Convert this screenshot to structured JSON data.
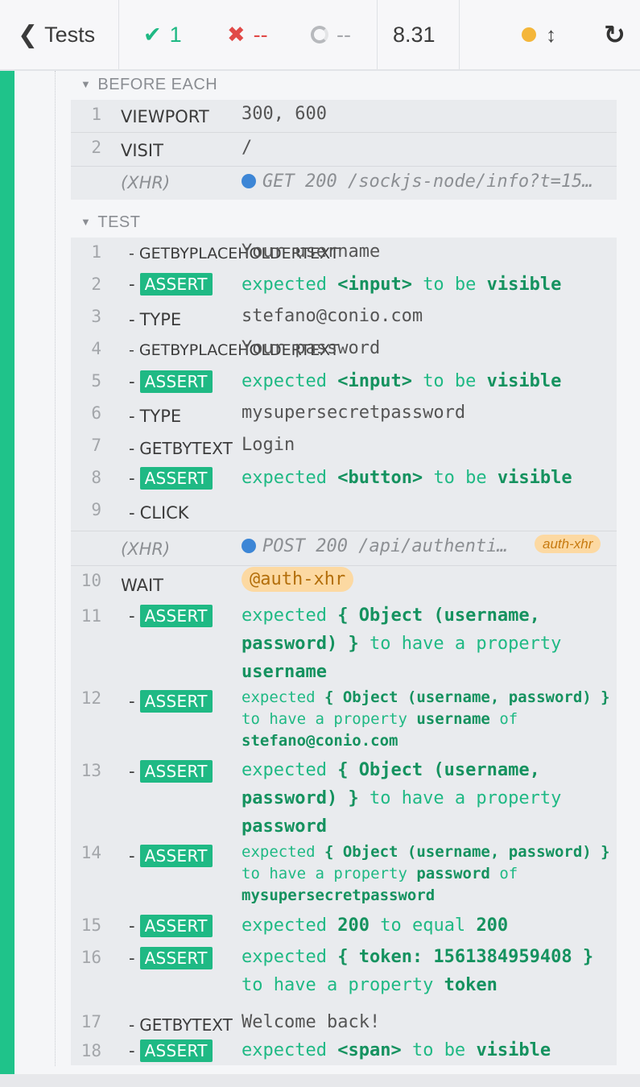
{
  "header": {
    "back_label": "Tests",
    "passed": "1",
    "failed": "--",
    "pending": "--",
    "duration": "8.31",
    "indicator_color": "#f4b63a"
  },
  "before_each": {
    "title": "BEFORE EACH",
    "commands": [
      {
        "num": "1",
        "name": "VIEWPORT",
        "message": "300, 600"
      },
      {
        "num": "2",
        "name": "VISIT",
        "message": "/"
      },
      {
        "num": "",
        "name": "(XHR)",
        "message": "GET 200 /sockjs-node/info?t=15…"
      }
    ]
  },
  "test": {
    "title": "TEST",
    "commands": [
      {
        "num": "1",
        "name": "GETBYPLACEHOLDERTEXT",
        "message": "Your username"
      },
      {
        "num": "2",
        "name": "ASSERT",
        "pre": "expected",
        "subject": "<input>",
        "mid": "to be",
        "value": "visible"
      },
      {
        "num": "3",
        "name": "TYPE",
        "message": "stefano@conio.com"
      },
      {
        "num": "4",
        "name": "GETBYPLACEHOLDERTEXT",
        "message": "Your password"
      },
      {
        "num": "5",
        "name": "ASSERT",
        "pre": "expected",
        "subject": "<input>",
        "mid": "to be",
        "value": "visible"
      },
      {
        "num": "6",
        "name": "TYPE",
        "message": "mysupersecretpassword"
      },
      {
        "num": "7",
        "name": "GETBYTEXT",
        "message": "Login"
      },
      {
        "num": "8",
        "name": "ASSERT",
        "pre": "expected",
        "subject": "<button>",
        "mid": "to be",
        "value": "visible"
      },
      {
        "num": "9",
        "name": "CLICK",
        "message": ""
      },
      {
        "num": "",
        "name": "(XHR)",
        "message": "POST 200 /api/authenti…",
        "alias": "auth-xhr"
      },
      {
        "num": "10",
        "name": "WAIT",
        "message": "@auth-xhr"
      },
      {
        "num": "11",
        "name": "ASSERT",
        "pre": "expected",
        "subject": "{ Object (username, password) }",
        "mid": "to have a property",
        "value": "username"
      },
      {
        "num": "12",
        "name": "ASSERT",
        "pre": "expected",
        "subject": "{ Object (username, password) }",
        "mid": "to have a property",
        "value": "username",
        "of": "of",
        "extra": "stefano@conio.com"
      },
      {
        "num": "13",
        "name": "ASSERT",
        "pre": "expected",
        "subject": "{ Object (username, password) }",
        "mid": "to have a property",
        "value": "password"
      },
      {
        "num": "14",
        "name": "ASSERT",
        "pre": "expected",
        "subject": "{ Object (username, password) }",
        "mid": "to have a property",
        "value": "password",
        "of": "of",
        "extra": "mysupersecretpassword"
      },
      {
        "num": "15",
        "name": "ASSERT",
        "pre": "expected",
        "subject": "200",
        "mid": "to equal",
        "value": "200"
      },
      {
        "num": "16",
        "name": "ASSERT",
        "pre": "expected",
        "subject": "{ token: 1561384959408 }",
        "mid": "to have a property",
        "value": "token"
      },
      {
        "num": "17",
        "name": "GETBYTEXT",
        "message": "Welcome back!"
      },
      {
        "num": "18",
        "name": "ASSERT",
        "pre": "expected",
        "subject": "<span>",
        "mid": "to be",
        "value": "visible"
      }
    ]
  }
}
